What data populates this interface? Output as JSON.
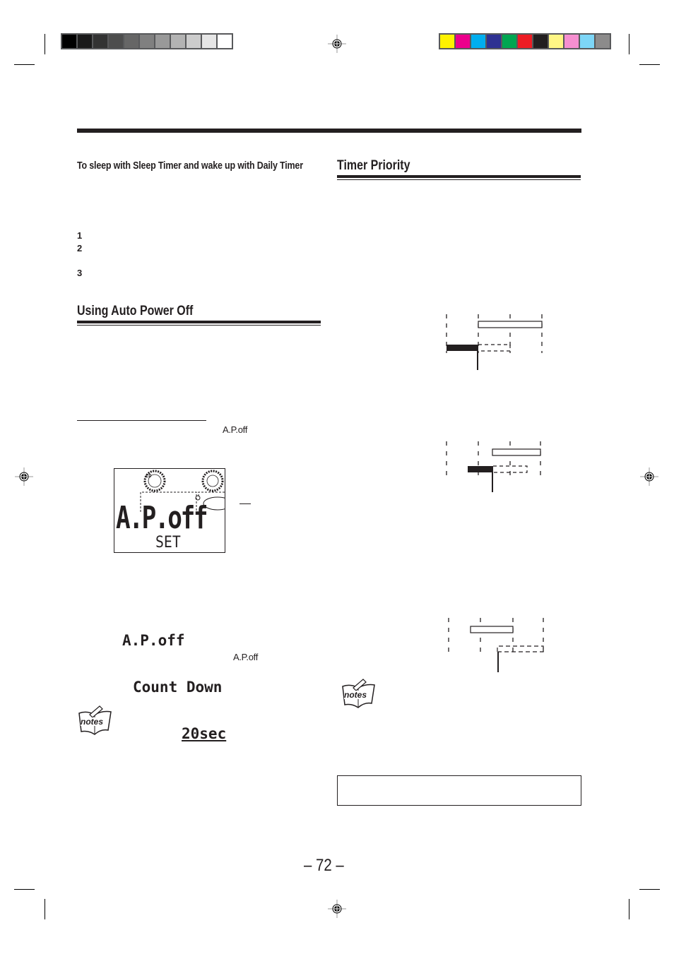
{
  "print_marks": {
    "grayscale_swatches": [
      "#000000",
      "#1a1a1a",
      "#333333",
      "#4d4d4d",
      "#666666",
      "#808080",
      "#999999",
      "#b3b3b3",
      "#cccccc",
      "#e6e6e6",
      "#ffffff"
    ],
    "color_swatches": [
      "#fff200",
      "#ec008c",
      "#00aeef",
      "#2e3192",
      "#00a651",
      "#ed1c24",
      "#231f20",
      "#fff685",
      "#f68fd0",
      "#7dd6f7",
      "#8c8b8b"
    ],
    "registration_marks": [
      "top-center",
      "left-middle",
      "right-middle",
      "bottom-center"
    ]
  },
  "left_column": {
    "subheading": "To sleep with Sleep Timer and wake up with Daily Timer",
    "steps": [
      "1",
      "2",
      "3"
    ],
    "section_title": "Using Auto Power Off",
    "label_apoff_1": "A.P.off",
    "lcd_display": {
      "disc_label": "CD",
      "main_text": "A.P.off",
      "sub_text": "SET"
    },
    "countdown_display": {
      "line1": "A.P.off",
      "line2": "Count Down",
      "line3": "20sec"
    },
    "label_apoff_2": "A.P.off",
    "notes_label": "notes"
  },
  "right_column": {
    "section_title": "Timer Priority",
    "notes_label": "notes"
  },
  "page_number": "– 72 –"
}
